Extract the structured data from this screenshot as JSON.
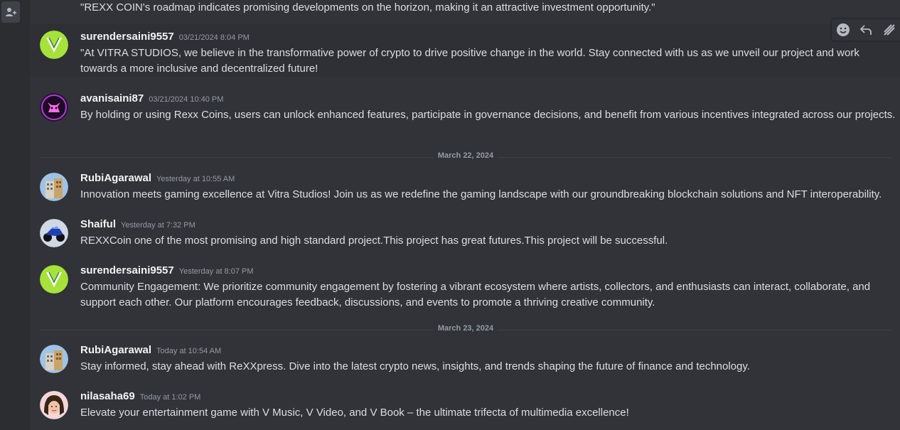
{
  "colors": {
    "background": "#313338",
    "rail": "#2b2d31",
    "username": "#f2f3f5",
    "timestamp": "#949ba4",
    "text": "#dbdee1"
  },
  "rail": {
    "icon": "add-friend-icon"
  },
  "toolbar": {
    "icons": [
      "add-reaction-icon",
      "reply-icon",
      "more-icon"
    ]
  },
  "top_continuation": "\"REXX COIN's roadmap indicates promising developments on the horizon, making it an attractive investment opportunity.\"",
  "messages": [
    {
      "username": "surendersaini9557",
      "timestamp": "03/21/2024 8:04 PM",
      "text": "\"At VITRA STUDIOS, we believe in the transformative power of crypto to drive positive change in the world. Stay connected with us as we unveil our project and work towards a more inclusive and decentralized future!",
      "avatar": "vitra-avatar"
    },
    {
      "username": "avanisaini87",
      "timestamp": "03/21/2024 10:40 PM",
      "text": "By holding or using Rexx Coins, users can unlock enhanced features, participate in governance decisions, and benefit from various incentives integrated across our projects.",
      "avatar": "pink-cat-avatar"
    },
    {
      "username": "RubiAgarawal",
      "timestamp": "Yesterday at 10:55 AM",
      "text": "Innovation meets gaming excellence at Vitra Studios! Join us as we redefine the gaming landscape with our groundbreaking blockchain solutions and NFT interoperability.",
      "avatar": "building-avatar"
    },
    {
      "username": "Shaiful",
      "timestamp": "Yesterday at 7:32 PM",
      "text": "REXXCoin one of the most promising and high standard project.This project has great futures.This project will be successful.",
      "avatar": "motorbike-avatar"
    },
    {
      "username": "surendersaini9557",
      "timestamp": "Yesterday at 8:07 PM",
      "text": "Community Engagement: We prioritize community engagement by fostering a vibrant ecosystem where artists, collectors, and enthusiasts can interact, collaborate, and support each other. Our platform encourages feedback, discussions, and events to promote a thriving creative community.",
      "avatar": "vitra-avatar"
    },
    {
      "username": "RubiAgarawal",
      "timestamp": "Today at 10:54 AM",
      "text": "Stay informed, stay ahead with ReXXpress. Dive into the latest crypto news, insights, and trends shaping the future of finance and technology.",
      "avatar": "building-avatar"
    },
    {
      "username": "nilasaha69",
      "timestamp": "Today at 1:02 PM",
      "text": "Elevate your entertainment game with V Music, V Video, and V Book – the ultimate trifecta of multimedia excellence!",
      "avatar": "woman-avatar"
    }
  ],
  "dividers": [
    "March 22, 2024",
    "March 23, 2024"
  ]
}
